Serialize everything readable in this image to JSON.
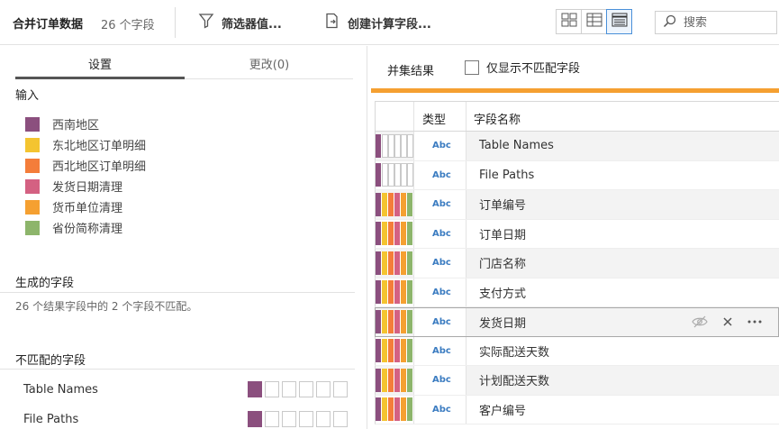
{
  "toolbar": {
    "title": "合并订单数据",
    "field_count": "26 个字段",
    "filter_label": "筛选器值...",
    "calc_label": "创建计算字段...",
    "search_placeholder": "搜索"
  },
  "left": {
    "tabs": [
      {
        "label": "设置",
        "active": true
      },
      {
        "label": "更改(0)",
        "active": false
      }
    ],
    "inputs_heading": "输入",
    "inputs": [
      {
        "label": "西南地区",
        "color": "#8b4f7e"
      },
      {
        "label": "东北地区订单明细",
        "color": "#f4c430"
      },
      {
        "label": "西北地区订单明细",
        "color": "#f47d3a"
      },
      {
        "label": "发货日期清理",
        "color": "#d46182"
      },
      {
        "label": "货币单位清理",
        "color": "#f5a031"
      },
      {
        "label": "省份简称清理",
        "color": "#8db56b"
      }
    ],
    "generated_heading": "生成的字段",
    "generated_desc": "26 个结果字段中的 2 个字段不匹配。",
    "mismatched_heading": "不匹配的字段",
    "mismatched": [
      {
        "name": "Table Names"
      },
      {
        "name": "File Paths"
      }
    ]
  },
  "right": {
    "title": "并集结果",
    "checkbox_label": "仅显示不匹配字段",
    "columns": {
      "type": "类型",
      "name": "字段名称"
    },
    "rows": [
      {
        "type": "Abc",
        "name": "Table Names",
        "full": false
      },
      {
        "type": "Abc",
        "name": "File Paths",
        "full": false
      },
      {
        "type": "Abc",
        "name": "订单编号",
        "full": true
      },
      {
        "type": "Abc",
        "name": "订单日期",
        "full": true
      },
      {
        "type": "Abc",
        "name": "门店名称",
        "full": true
      },
      {
        "type": "Abc",
        "name": "支付方式",
        "full": true
      },
      {
        "type": "Abc",
        "name": "发货日期",
        "full": true
      },
      {
        "type": "Abc",
        "name": "实际配送天数",
        "full": true
      },
      {
        "type": "Abc",
        "name": "计划配送天数",
        "full": true
      },
      {
        "type": "Abc",
        "name": "客户编号",
        "full": true
      }
    ],
    "selected_row": 6,
    "input_colors": [
      "#8b4f7e",
      "#f4c430",
      "#f47d3a",
      "#d46182",
      "#f5a031",
      "#8db56b"
    ]
  }
}
